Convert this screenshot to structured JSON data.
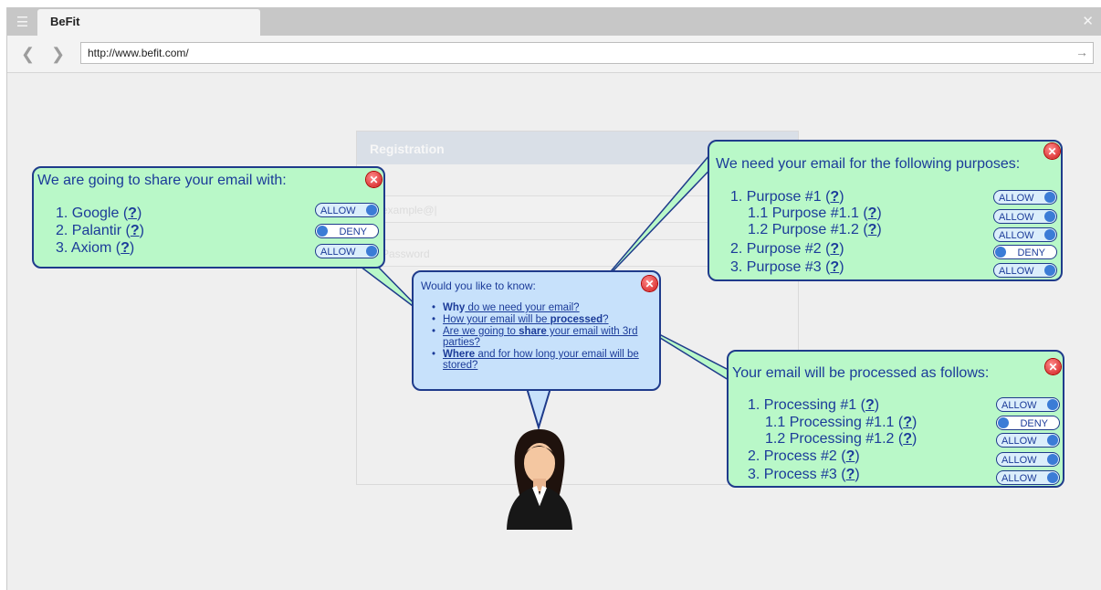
{
  "browser": {
    "tab_title": "BeFit",
    "url": "http://www.befit.com/"
  },
  "background_form": {
    "title": "Registration",
    "email_placeholder": "example@|",
    "password_placeholder": "Password"
  },
  "share_bubble": {
    "title": "We are going to share your email with:",
    "items": [
      {
        "label": "1. Google (",
        "help": "?",
        "close": ")",
        "state": "ALLOW"
      },
      {
        "label": "2. Palantir (",
        "help": "?",
        "close": ")",
        "state": "DENY"
      },
      {
        "label": "3. Axiom (",
        "help": "?",
        "close": ")",
        "state": "ALLOW"
      }
    ]
  },
  "question_bubble": {
    "title": "Would you like to know:",
    "q1_bold": "Why",
    "q1_rest": " do we need your email?",
    "q2_start": "How your email will be ",
    "q2_bold": "processed",
    "q2_end": "?",
    "q3_start": "Are we going to ",
    "q3_bold": "share",
    "q3_rest": " your email with 3rd parties?",
    "q4_bold": "Where",
    "q4_rest": " and for how long your email will be stored?"
  },
  "purposes_bubble": {
    "title": "We need your email for the following purposes:",
    "items": [
      {
        "label": "1. Purpose #1 (",
        "help": "?",
        "close": ")",
        "state": "ALLOW"
      },
      {
        "label": "1.1 Purpose #1.1 (",
        "help": "?",
        "close": ")",
        "state": "ALLOW"
      },
      {
        "label": "1.2 Purpose #1.2 (",
        "help": "?",
        "close": ")",
        "state": "ALLOW"
      },
      {
        "label": "2. Purpose #2 (",
        "help": "?",
        "close": ")",
        "state": "DENY"
      },
      {
        "label": "3. Purpose #3 (",
        "help": "?",
        "close": ")",
        "state": "ALLOW"
      }
    ]
  },
  "processing_bubble": {
    "title": "Your email will be processed as follows:",
    "items": [
      {
        "label": "1. Processing #1 (",
        "help": "?",
        "close": ")",
        "state": "ALLOW"
      },
      {
        "label": "1.1 Processing #1.1 (",
        "help": "?",
        "close": ")",
        "state": "DENY"
      },
      {
        "label": "1.2 Processing #1.2 (",
        "help": "?",
        "close": ")",
        "state": "ALLOW"
      },
      {
        "label": "2. Process #2 (",
        "help": "?",
        "close": ")",
        "state": "ALLOW"
      },
      {
        "label": "3. Process #3 (",
        "help": "?",
        "close": ")",
        "state": "ALLOW"
      }
    ]
  },
  "colors": {
    "bubble_green": "#b9f8c8",
    "bubble_blue": "#c7e1fb",
    "bubble_border": "#1f3b8b",
    "text": "#1b3b99",
    "close_red": "#d01818"
  },
  "icons": {
    "menu": "hamburger-icon",
    "close_window": "close-icon",
    "back": "back-arrow-icon",
    "forward": "forward-arrow-icon",
    "go": "go-arrow-icon",
    "bubble_close": "red-close-circle-icon",
    "person": "user-avatar-icon"
  }
}
